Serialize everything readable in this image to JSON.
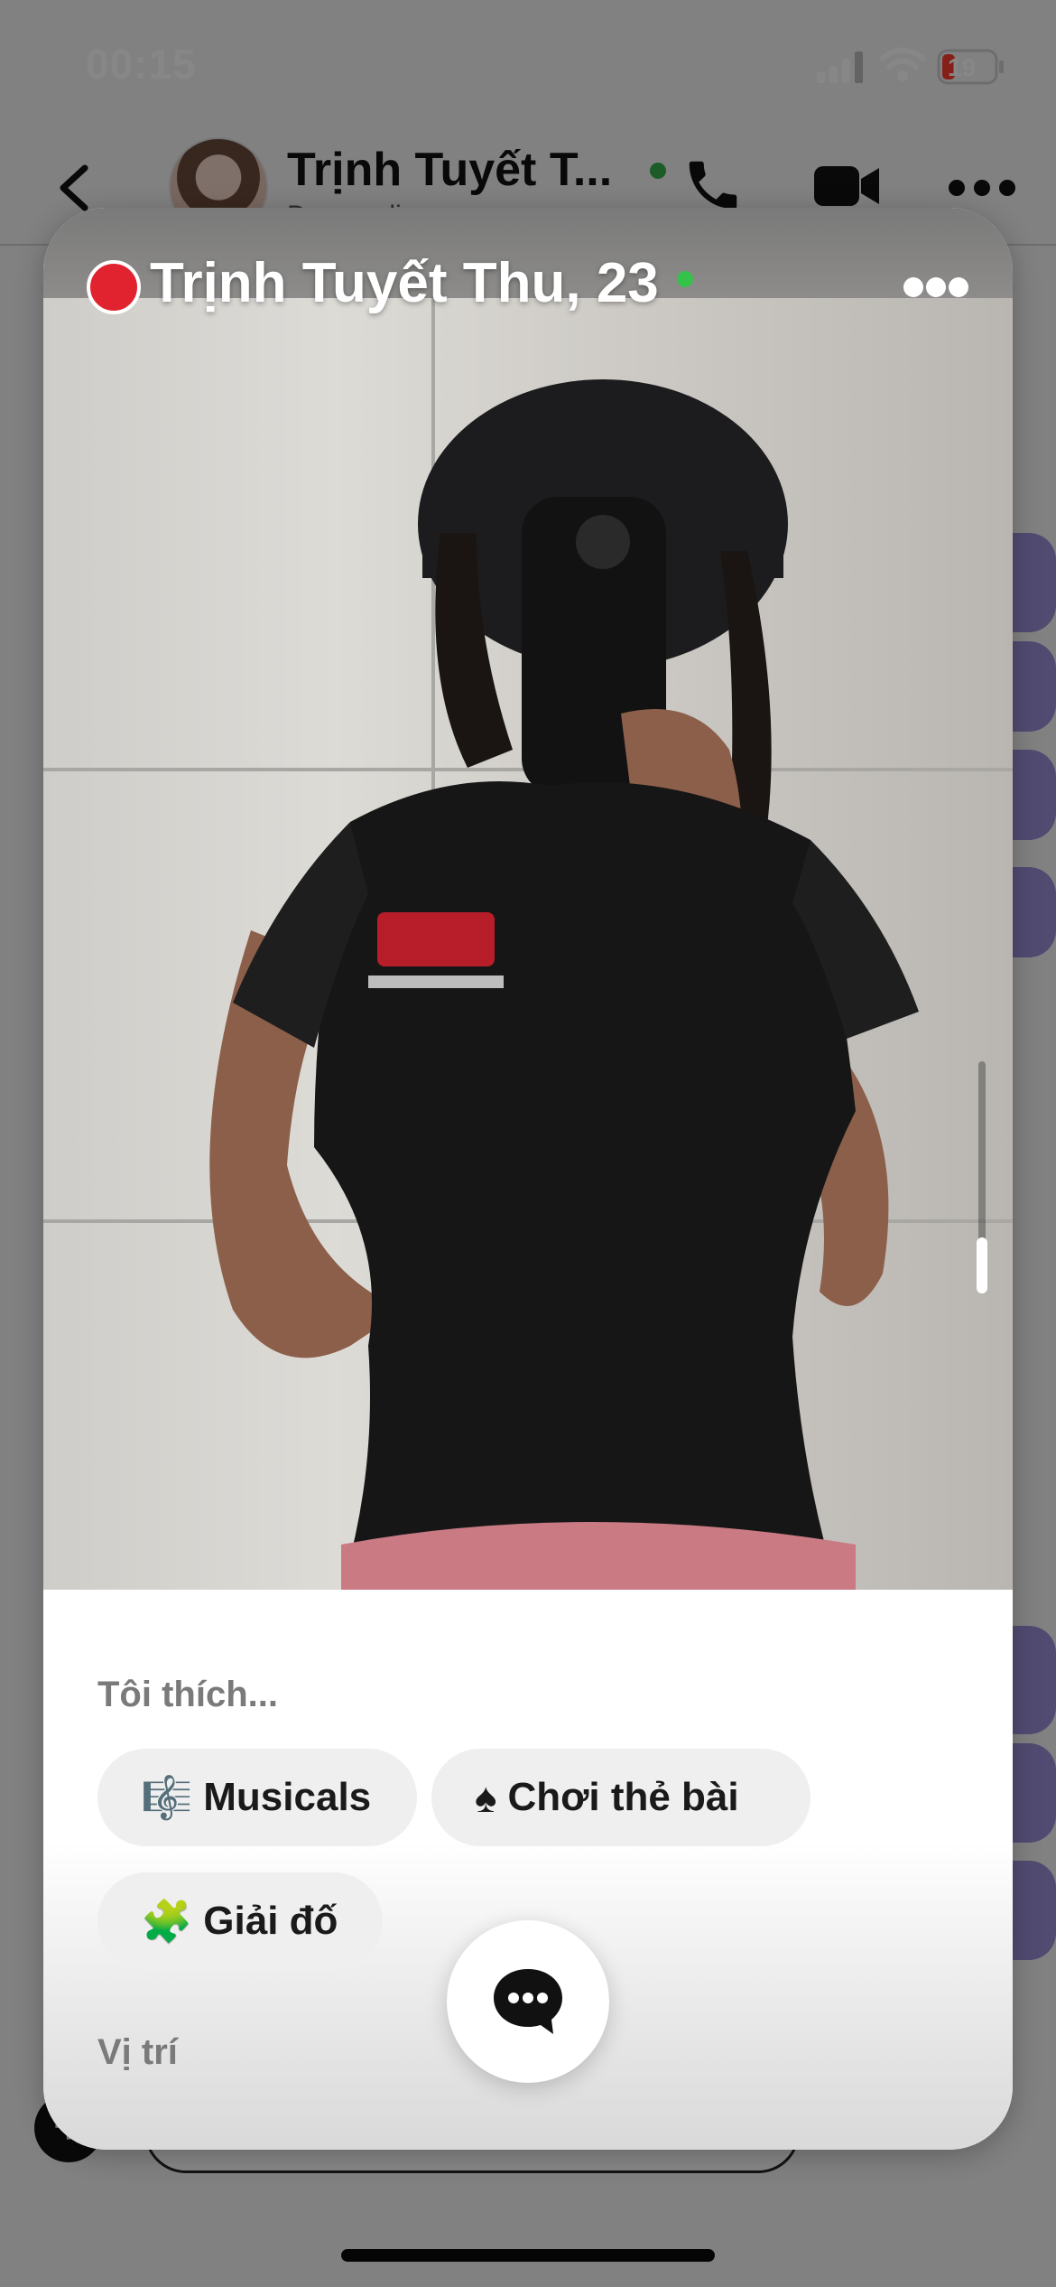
{
  "status_bar": {
    "time": "00:15",
    "battery": "19"
  },
  "chat_header": {
    "name": "Trịnh Tuyết T...",
    "subtitle": "Đang online"
  },
  "profile_card": {
    "name_age": "Trịnh Tuyết Thu, 23",
    "online": true,
    "interests_title": "Tôi thích...",
    "interests": [
      {
        "icon": "music-sheet-icon",
        "glyph": "🎼",
        "label": "Musicals"
      },
      {
        "icon": "spade-icon",
        "glyph": "♠",
        "label": "Chơi thẻ bài"
      },
      {
        "icon": "puzzle-icon",
        "glyph": "🧩",
        "label": "Giải đố"
      }
    ],
    "location_title": "Vị trí"
  },
  "colors": {
    "online_green": "#35c24b",
    "brand_red": "#e0232f",
    "chip_bg": "#efefef",
    "chat_accent": "#9a8fd8"
  }
}
